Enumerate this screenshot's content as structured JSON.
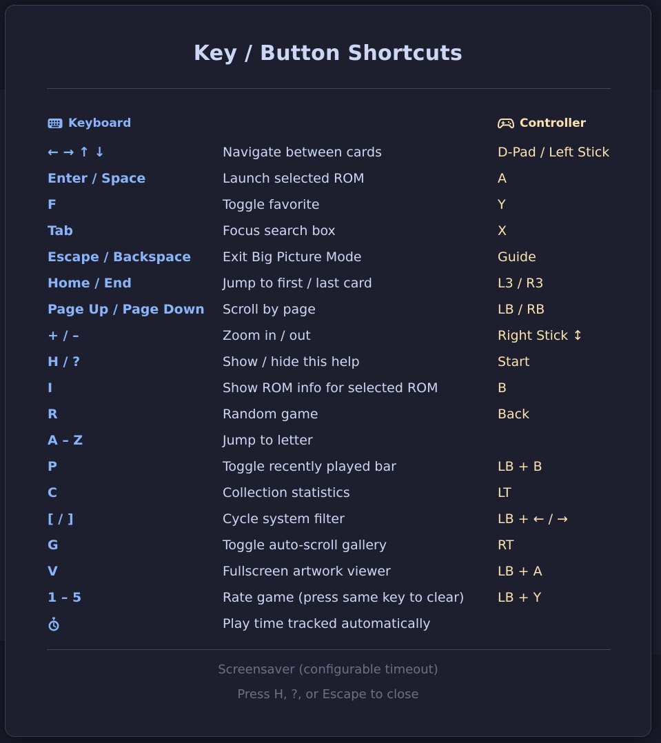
{
  "title": "Key / Button Shortcuts",
  "columns": {
    "keyboard_label": "Keyboard",
    "keyboard_icon": "keyboard-icon",
    "controller_label": "Controller",
    "controller_icon": "gamepad-icon"
  },
  "shortcuts": [
    {
      "key": "← → ↑ ↓",
      "description": "Navigate between cards",
      "controller": "D-Pad / Left Stick"
    },
    {
      "key": "Enter / Space",
      "description": "Launch selected ROM",
      "controller": "A"
    },
    {
      "key": "F",
      "description": "Toggle favorite",
      "controller": "Y"
    },
    {
      "key": "Tab",
      "description": "Focus search box",
      "controller": "X"
    },
    {
      "key": "Escape / Backspace",
      "description": "Exit Big Picture Mode",
      "controller": "Guide"
    },
    {
      "key": "Home / End",
      "description": "Jump to first / last card",
      "controller": "L3 / R3"
    },
    {
      "key": "Page Up / Page Down",
      "description": "Scroll by page",
      "controller": "LB / RB"
    },
    {
      "key": "+ / –",
      "description": "Zoom in / out",
      "controller": "Right Stick ↕"
    },
    {
      "key": "H / ?",
      "description": "Show / hide this help",
      "controller": "Start"
    },
    {
      "key": "I",
      "description": "Show ROM info for selected ROM",
      "controller": "B"
    },
    {
      "key": "R",
      "description": "Random game",
      "controller": "Back"
    },
    {
      "key": "A – Z",
      "description": "Jump to letter",
      "controller": ""
    },
    {
      "key": "P",
      "description": "Toggle recently played bar",
      "controller": "LB + B"
    },
    {
      "key": "C",
      "description": "Collection statistics",
      "controller": "LT"
    },
    {
      "key": "[ / ]",
      "description": "Cycle system filter",
      "controller": "LB + ← / →"
    },
    {
      "key": "G",
      "description": "Toggle auto-scroll gallery",
      "controller": "RT"
    },
    {
      "key": "V",
      "description": "Fullscreen artwork viewer",
      "controller": "LB + A"
    },
    {
      "key": "1 – 5",
      "description": "Rate game (press same key to clear)",
      "controller": "LB + Y"
    },
    {
      "key": "",
      "key_icon": "stopwatch-icon",
      "description": "Play time tracked automatically",
      "controller": ""
    }
  ],
  "footer": {
    "note": "Screensaver (configurable timeout)",
    "hint": "Press H, ?, or Escape to close"
  },
  "colors": {
    "key": "#89b4fa",
    "description": "#cdd6f4",
    "controller": "#f9e2af",
    "muted": "#6c7086",
    "panel": "#1e1f2e"
  }
}
